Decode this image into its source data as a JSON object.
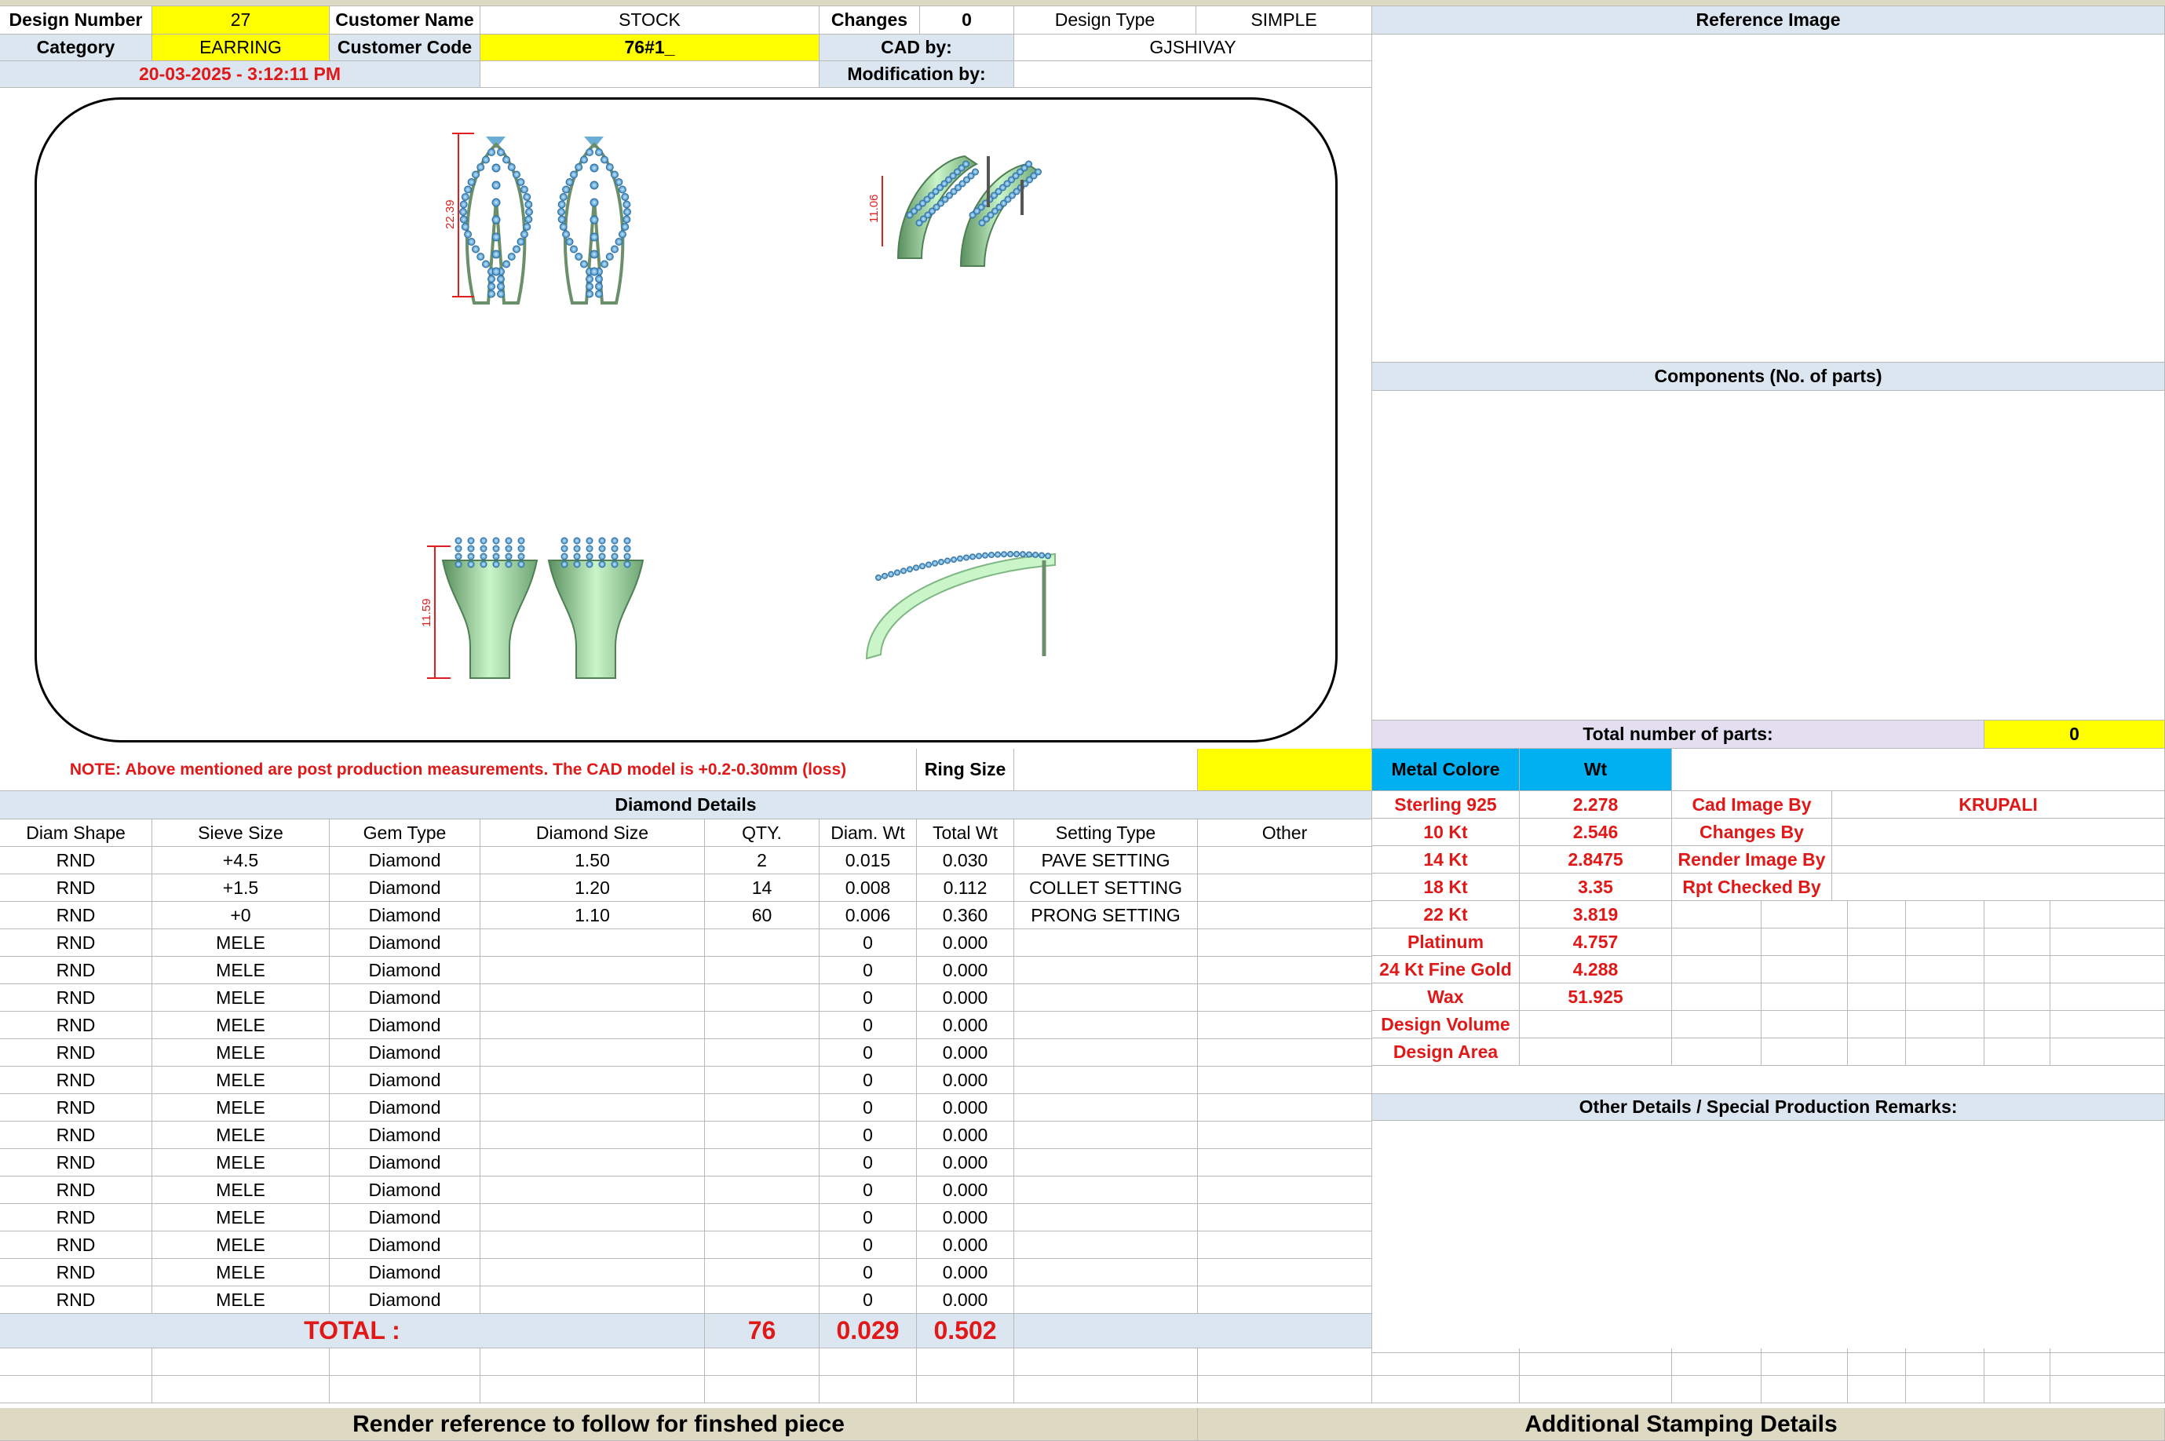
{
  "header": {
    "design_number_label": "Design Number",
    "design_number": "27",
    "customer_name_label": "Customer Name",
    "customer_name": "STOCK",
    "changes_label": "Changes",
    "changes": "0",
    "design_type_label": "Design Type",
    "design_type": "SIMPLE",
    "category_label": "Category",
    "category": "EARRING",
    "customer_code_label": "Customer Code",
    "customer_code": "76#1_",
    "cad_by_label": "CAD by:",
    "cad_by": "GJSHIVAY",
    "timestamp": "20-03-2025 - 3:12:11 PM",
    "modification_label": "Modification by:",
    "modification_by": ""
  },
  "renders": {
    "front_dimension": "22.39",
    "side_dimension": "11.59",
    "angle_dimension": "11.06"
  },
  "note": "NOTE: Above mentioned are post production measurements. The CAD model is +0.2-0.30mm (loss)",
  "ring_size_label": "Ring Size",
  "ring_size": "",
  "diamond_details": {
    "title": "Diamond Details",
    "columns": [
      "Diam Shape",
      "Sieve Size",
      "Gem Type",
      "Diamond Size",
      "QTY.",
      "Diam. Wt",
      "Total Wt",
      "Setting Type",
      "Other"
    ],
    "rows": [
      [
        "RND",
        "+4.5",
        "Diamond",
        "1.50",
        "2",
        "0.015",
        "0.030",
        "PAVE SETTING",
        ""
      ],
      [
        "RND",
        "+1.5",
        "Diamond",
        "1.20",
        "14",
        "0.008",
        "0.112",
        "COLLET SETTING",
        ""
      ],
      [
        "RND",
        "+0",
        "Diamond",
        "1.10",
        "60",
        "0.006",
        "0.360",
        "PRONG SETTING",
        ""
      ],
      [
        "RND",
        "MELE",
        "Diamond",
        "",
        "",
        "0",
        "0.000",
        "",
        ""
      ],
      [
        "RND",
        "MELE",
        "Diamond",
        "",
        "",
        "0",
        "0.000",
        "",
        ""
      ],
      [
        "RND",
        "MELE",
        "Diamond",
        "",
        "",
        "0",
        "0.000",
        "",
        ""
      ],
      [
        "RND",
        "MELE",
        "Diamond",
        "",
        "",
        "0",
        "0.000",
        "",
        ""
      ],
      [
        "RND",
        "MELE",
        "Diamond",
        "",
        "",
        "0",
        "0.000",
        "",
        ""
      ],
      [
        "RND",
        "MELE",
        "Diamond",
        "",
        "",
        "0",
        "0.000",
        "",
        ""
      ],
      [
        "RND",
        "MELE",
        "Diamond",
        "",
        "",
        "0",
        "0.000",
        "",
        ""
      ],
      [
        "RND",
        "MELE",
        "Diamond",
        "",
        "",
        "0",
        "0.000",
        "",
        ""
      ],
      [
        "RND",
        "MELE",
        "Diamond",
        "",
        "",
        "0",
        "0.000",
        "",
        ""
      ],
      [
        "RND",
        "MELE",
        "Diamond",
        "",
        "",
        "0",
        "0.000",
        "",
        ""
      ],
      [
        "RND",
        "MELE",
        "Diamond",
        "",
        "",
        "0",
        "0.000",
        "",
        ""
      ],
      [
        "RND",
        "MELE",
        "Diamond",
        "",
        "",
        "0",
        "0.000",
        "",
        ""
      ],
      [
        "RND",
        "MELE",
        "Diamond",
        "",
        "",
        "0",
        "0.000",
        "",
        ""
      ],
      [
        "RND",
        "MELE",
        "Diamond",
        "",
        "",
        "0",
        "0.000",
        "",
        ""
      ]
    ],
    "total_label": "TOTAL :",
    "total_qty": "76",
    "total_diam_wt": "0.029",
    "total_wt": "0.502"
  },
  "right_panel": {
    "reference_image_title": "Reference Image",
    "components_title": "Components (No. of parts)",
    "total_parts_label": "Total number of parts:",
    "total_parts": "0",
    "metal_colore_label": "Metal Colore",
    "wt_label": "Wt",
    "metals": [
      {
        "name": "Sterling 925",
        "wt": "2.278"
      },
      {
        "name": "10 Kt",
        "wt": "2.546"
      },
      {
        "name": "14 Kt",
        "wt": "2.8475"
      },
      {
        "name": "18 Kt",
        "wt": "3.35"
      },
      {
        "name": "22 Kt",
        "wt": "3.819"
      },
      {
        "name": "Platinum",
        "wt": "4.757"
      },
      {
        "name": "24 Kt Fine Gold",
        "wt": "4.288"
      },
      {
        "name": "Wax",
        "wt": "51.925"
      },
      {
        "name": "Design Volume",
        "wt": ""
      },
      {
        "name": "Design Area",
        "wt": ""
      }
    ],
    "cad_image_by_label": "Cad Image By",
    "cad_image_by": "KRUPALI",
    "changes_by_label": "Changes By",
    "render_image_by_label": "Render Image By",
    "rpt_checked_by_label": "Rpt Checked By",
    "other_details_title": "Other Details / Special Production Remarks:"
  },
  "footer": {
    "render_reference": "Render reference to follow for finshed piece",
    "additional_stamping": "Additional Stamping Details"
  },
  "colors": {
    "highlight_yellow": "#ffff00",
    "header_blue": "#dce6f1",
    "metal_blue": "#00b0f0",
    "footer_tan": "#ddd9c3",
    "red_text": "#e01818",
    "metal_green": "#9ee8a8",
    "stone_blue": "#6aaed6"
  }
}
